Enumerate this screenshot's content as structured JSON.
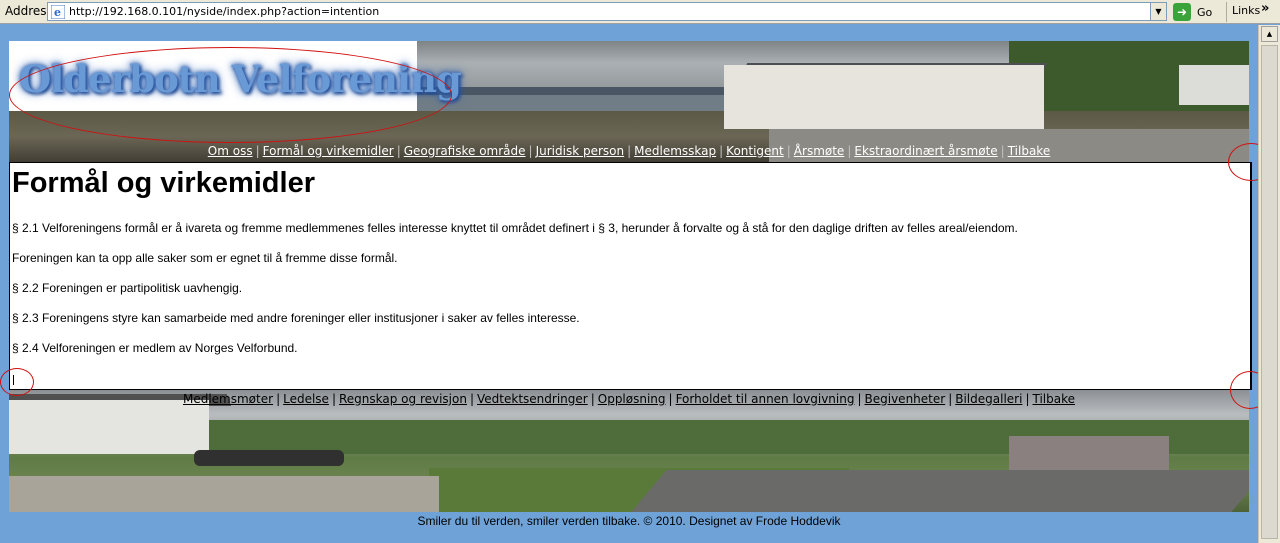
{
  "browser": {
    "address_label": "Address",
    "url": "http://192.168.0.101/nyside/index.php?action=intention",
    "go_label": "Go",
    "links_label": "Links",
    "links_chevron": "»"
  },
  "header": {
    "logo_text": "Olderbotn Velforening",
    "nav": [
      "Om oss",
      "Formål og virkemidler",
      "Geografiske område",
      "Juridisk person",
      "Medlemsskap",
      "Kontigent",
      "Årsmøte",
      "Ekstraordinært årsmøte",
      "Tilbake"
    ]
  },
  "content": {
    "title": "Formål og virkemidler",
    "paragraphs": [
      "§ 2.1 Velforeningens formål er å ivareta og fremme medlemmenes felles interesse knyttet til området definert i § 3, herunder å forvalte og å stå for den daglige driften av felles areal/eiendom.",
      "Foreningen kan ta opp alle saker som er egnet til å fremme disse formål.",
      "§ 2.2 Foreningen er partipolitisk uavhengig.",
      "§ 2.3 Foreningens styre kan samarbeide med andre foreninger eller institusjoner i saker av felles interesse.",
      "§ 2.4 Velforeningen er medlem av Norges Velforbund."
    ]
  },
  "footer": {
    "nav": [
      "Medlemsmøter",
      "Ledelse",
      "Regnskap og revisjon",
      "Vedtektsendringer",
      "Oppløsning",
      "Forholdet til annen lovgivning",
      "Begivenheter",
      "Bildegalleri",
      "Tilbake"
    ],
    "separator": "|",
    "credit": "Smiler du til verden, smiler verden tilbake. © 2010. Designet av Frode Hoddevik"
  },
  "colors": {
    "page_background": "#6fa3d8",
    "annotation_ring": "#d01010",
    "logo_text": "#6a9ad6"
  },
  "icons": [
    "ie-page-icon",
    "dropdown-arrow-icon",
    "go-arrow-icon",
    "scroll-up-arrow-icon"
  ]
}
